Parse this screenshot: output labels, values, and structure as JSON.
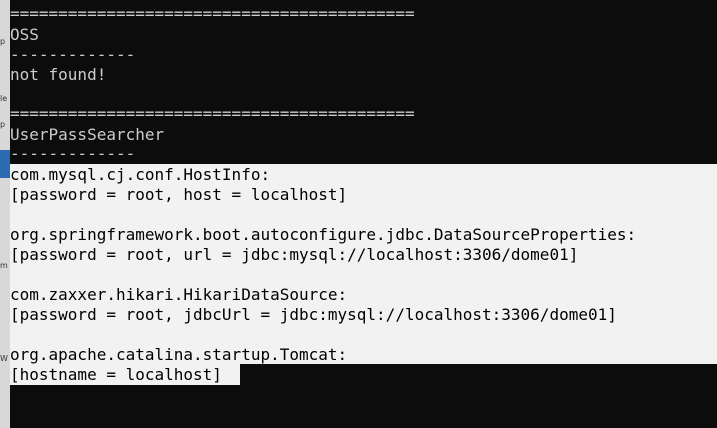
{
  "left_strip": {
    "fragments": [
      "p",
      "le",
      "p",
      "m",
      "W"
    ]
  },
  "console": {
    "lines": [
      "==========================================",
      "OSS",
      "-------------",
      "not found!",
      "",
      "==========================================",
      "UserPassSearcher",
      "-------------",
      "com.mysql.cj.conf.HostInfo:",
      "[password = root, host = localhost]",
      "",
      "org.springframework.boot.autoconfigure.jdbc.DataSourceProperties:",
      "[password = root, url = jdbc:mysql://localhost:3306/dome01]",
      "",
      "com.zaxxer.hikari.HikariDataSource:",
      "[password = root, jdbcUrl = jdbc:mysql://localhost:3306/dome01]",
      "",
      "org.apache.catalina.startup.Tomcat:",
      "[hostname = localhost]"
    ]
  },
  "colors": {
    "background": "#0c0c0c",
    "text": "#cccccc",
    "selection_bg": "#f2f2f2",
    "selection_text": "#000000"
  }
}
